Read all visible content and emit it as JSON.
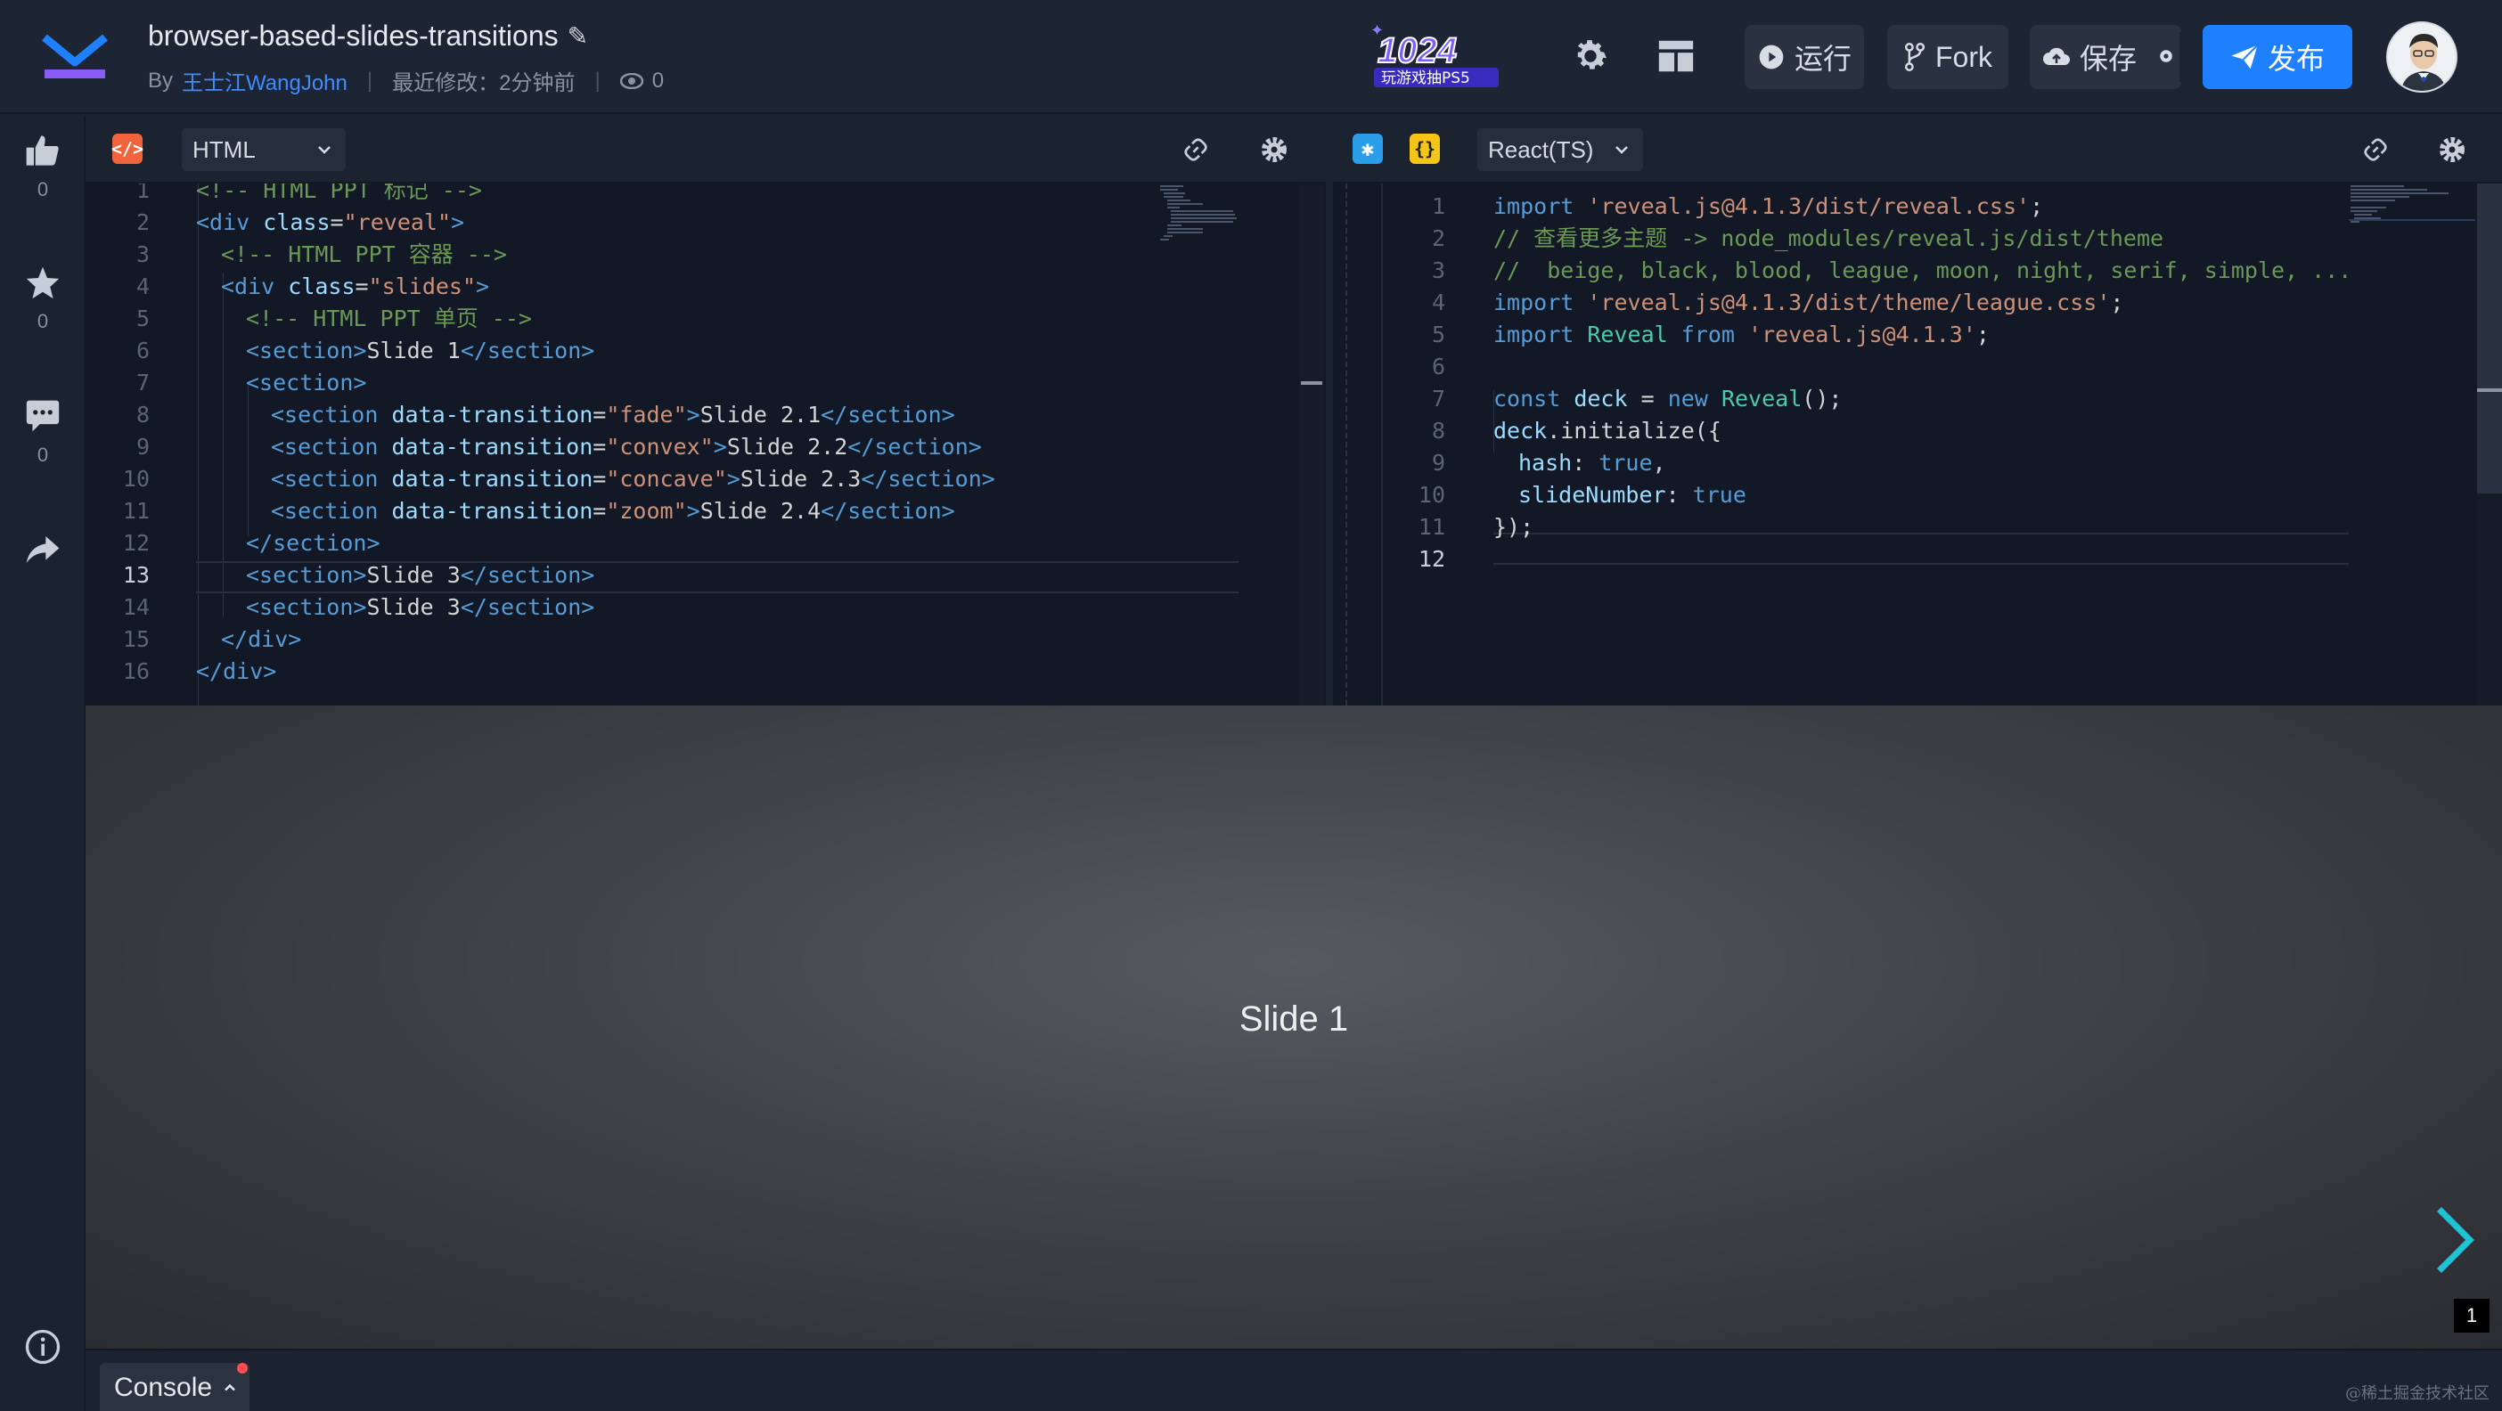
{
  "header": {
    "title": "browser-based-slides-transitions",
    "by_label": "By",
    "author": "王士江WangJohn",
    "modified": "最近修改：2分钟前",
    "views": "0",
    "run_label": "运行",
    "fork_label": "Fork",
    "save_label": "保存",
    "publish_label": "发布",
    "banner_text": "1024",
    "banner_sub": "玩游戏抽PS5"
  },
  "sidebar": {
    "like_count": "0",
    "star_count": "0",
    "comment_count": "0"
  },
  "html_editor": {
    "language": "HTML",
    "lines": [
      "1",
      "2",
      "3",
      "4",
      "5",
      "6",
      "7",
      "8",
      "9",
      "10",
      "11",
      "12",
      "13",
      "14",
      "15",
      "16"
    ]
  },
  "ts_editor": {
    "language": "React(TS)",
    "lines": [
      "1",
      "2",
      "3",
      "4",
      "5",
      "6",
      "7",
      "8",
      "9",
      "10",
      "11",
      "12"
    ]
  },
  "preview": {
    "slide_text": "Slide 1",
    "slide_number": "1"
  },
  "console": {
    "label": "Console"
  },
  "watermark": "@稀土掘金技术社区",
  "colors": {
    "accent": "#1e80ff",
    "html_icon": "#f0633b",
    "ts_icon": "#f5c518",
    "preprocess_icon": "#2a9ee8"
  }
}
